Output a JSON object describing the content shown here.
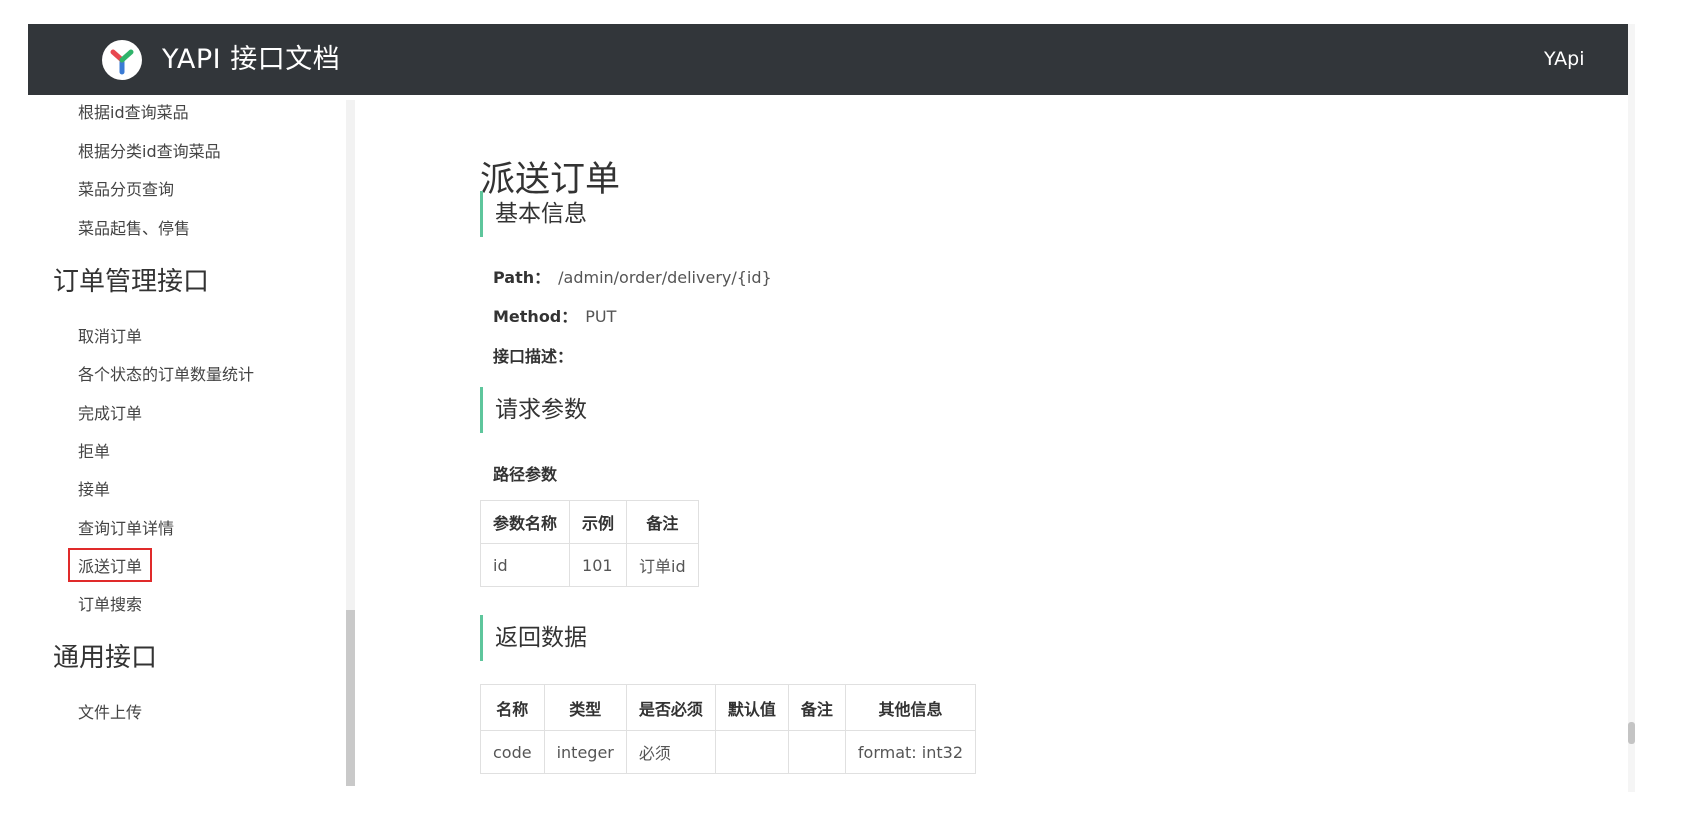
{
  "header": {
    "brand": "YAPI 接口文档",
    "right_link": "YApi"
  },
  "sidebar": {
    "items_top": [
      "根据id查询菜品",
      "根据分类id查询菜品",
      "菜品分页查询",
      "菜品起售、停售"
    ],
    "group_order": "订单管理接口",
    "items_order": [
      "取消订单",
      "各个状态的订单数量统计",
      "完成订单",
      "拒单",
      "接单",
      "查询订单详情",
      "派送订单",
      "订单搜索"
    ],
    "active_item": "派送订单",
    "group_common": "通用接口",
    "items_common": [
      "文件上传"
    ]
  },
  "main": {
    "title": "派送订单",
    "basic": {
      "heading": "基本信息",
      "path_label": "Path：",
      "path_value": "/admin/order/delivery/{id}",
      "method_label": "Method：",
      "method_value": "PUT",
      "desc_label": "接口描述："
    },
    "request": {
      "heading": "请求参数",
      "path_params_label": "路径参数",
      "columns": [
        "参数名称",
        "示例",
        "备注"
      ],
      "rows": [
        [
          "id",
          "101",
          "订单id"
        ]
      ]
    },
    "response": {
      "heading": "返回数据",
      "columns": [
        "名称",
        "类型",
        "是否必须",
        "默认值",
        "备注",
        "其他信息"
      ],
      "rows": [
        [
          "code",
          "integer",
          "必须",
          "",
          "",
          "format: int32"
        ]
      ]
    }
  },
  "colors": {
    "header_bg": "#32363a",
    "accent": "#5ec69c",
    "active_outline": "#e02a2a"
  }
}
